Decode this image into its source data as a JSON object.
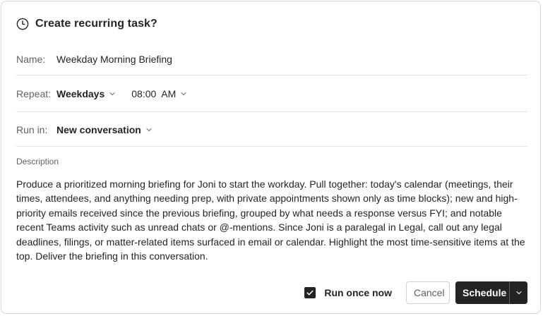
{
  "dialog": {
    "title": "Create recurring task?",
    "icon": "clock-icon"
  },
  "name_field": {
    "label": "Name:",
    "value": "Weekday Morning Briefing"
  },
  "repeat_field": {
    "label": "Repeat:",
    "frequency": "Weekdays",
    "time": "08:00",
    "ampm": "AM"
  },
  "run_in_field": {
    "label": "Run in:",
    "value": "New conversation"
  },
  "description": {
    "label": "Description",
    "text": "Produce a prioritized morning briefing for Joni to start the workday. Pull together: today's calendar (meetings, their times, attendees, and anything needing prep, with private appointments shown only as time blocks); new and high-priority emails received since the previous briefing, grouped by what needs a response versus FYI; and notable recent Teams activity such as unread chats or @-mentions. Since Joni is a paralegal in Legal, call out any legal deadlines, filings, or matter-related items surfaced in email or calendar. Highlight the most time-sensitive items at the top. Deliver the briefing in this conversation."
  },
  "footer": {
    "run_once_label": "Run once now",
    "run_once_checked": true,
    "cancel_label": "Cancel",
    "schedule_label": "Schedule"
  },
  "colors": {
    "primary": "#242424",
    "label": "#616161",
    "border": "#e1e1e1"
  }
}
